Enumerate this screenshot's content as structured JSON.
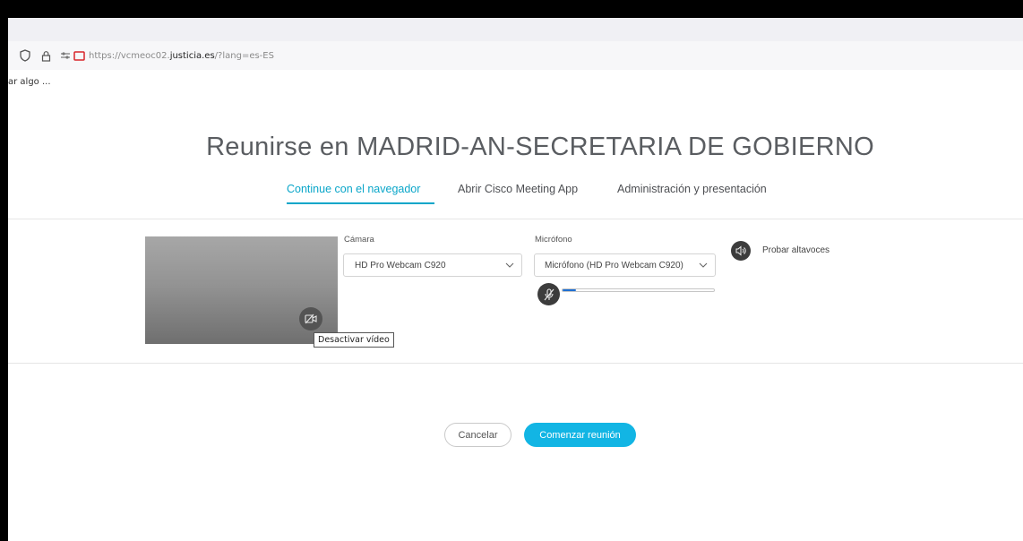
{
  "browser": {
    "url_prefix": "https://vcmeoc02.",
    "url_domain": "justicia.es",
    "url_suffix": "/?lang=es-ES",
    "bookmark_text": "ar algo ..."
  },
  "meeting": {
    "title": "Reunirse en MADRID-AN-SECRETARIA DE GOBIERNO",
    "tabs": [
      {
        "label": "Continue con el navegador",
        "active": true
      },
      {
        "label": "Abrir Cisco Meeting App",
        "active": false
      },
      {
        "label": "Administración y presentación",
        "active": false
      }
    ]
  },
  "devices": {
    "camera_label": "Cámara",
    "camera_value": "HD Pro Webcam C920",
    "mic_label": "Micrófono",
    "mic_value": "Micrófono (HD Pro Webcam C920)",
    "mic_level": 0.09,
    "speaker_test": "Probar altavoces",
    "video_tooltip": "Desactivar vídeo"
  },
  "actions": {
    "cancel": "Cancelar",
    "start": "Comenzar reunión"
  },
  "colors": {
    "accent": "#0aa6c9",
    "primary_button": "#12b5e4",
    "level_fill": "#1f6fd1"
  },
  "icons": [
    "shield-icon",
    "lock-icon",
    "permissions-icon",
    "camera-permission-icon",
    "chevron-down-icon",
    "video-off-icon",
    "mic-off-icon",
    "speaker-icon"
  ]
}
